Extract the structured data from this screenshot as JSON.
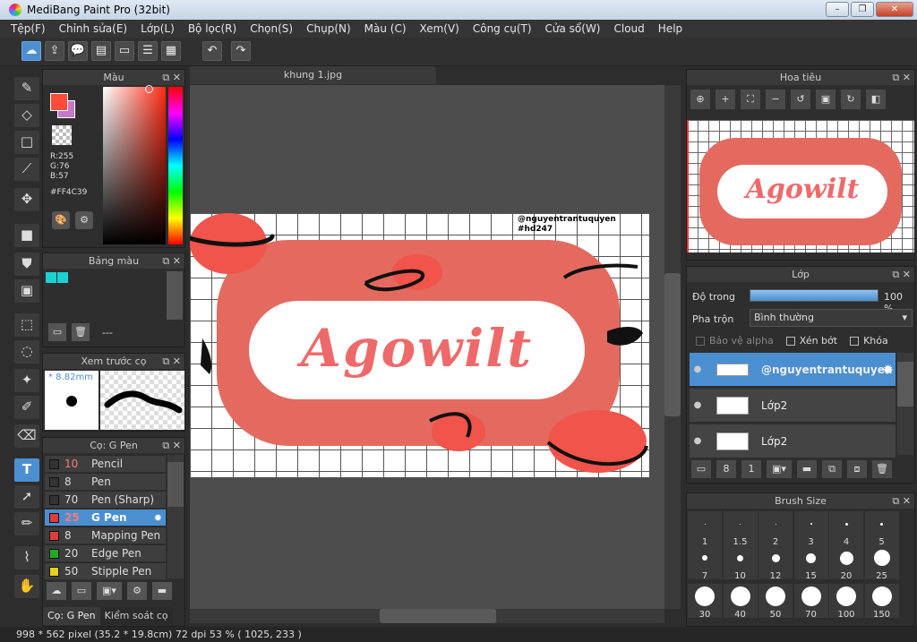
{
  "window": {
    "title": "MediBang Paint Pro (32bit)",
    "minimize": "–",
    "maximize": "❐",
    "close": "✕"
  },
  "menu": [
    "Tệp(F)",
    "Chỉnh sửa(E)",
    "Lớp(L)",
    "Bộ lọc(R)",
    "Chọn(S)",
    "Chụp(N)",
    "Màu (C)",
    "Xem(V)",
    "Công cụ(T)",
    "Cửa sổ(W)",
    "Cloud",
    "Help"
  ],
  "toolbar_icons": [
    "cloud-icon",
    "upload-icon",
    "speech-icon",
    "comment-icon",
    "page-icon",
    "list-icon",
    "edit-list-icon",
    "undo-icon",
    "redo-icon"
  ],
  "color_panel": {
    "title": "Màu",
    "r": "R:255",
    "g": "G:76",
    "b": "B:57",
    "hex": "#FF4C39",
    "fg": "#FF4C39",
    "bg": "#c678c8"
  },
  "palette_panel": {
    "title": "Bảng màu",
    "dash": "---",
    "swatches": [
      "#19d3d3",
      "#19d3d3"
    ]
  },
  "preview_panel": {
    "title": "Xem trước cọ",
    "size": "* 8.82mm"
  },
  "brush_panel": {
    "title": "Cọ: G Pen",
    "brushes": [
      {
        "size": "10",
        "name": "Pencil",
        "color": "#333333",
        "size_color": "#ff7a7a"
      },
      {
        "size": "8",
        "name": "Pen",
        "color": "#333333",
        "size_color": "#eeeeee"
      },
      {
        "size": "70",
        "name": "Pen (Sharp)",
        "color": "#333333",
        "size_color": "#eeeeee"
      },
      {
        "size": "25",
        "name": "G Pen",
        "color": "#e23b3b",
        "size_color": "#ff7a7a"
      },
      {
        "size": "8",
        "name": "Mapping Pen",
        "color": "#e23b3b",
        "size_color": "#eeeeee"
      },
      {
        "size": "20",
        "name": "Edge Pen",
        "color": "#22aa22",
        "size_color": "#eeeeee"
      },
      {
        "size": "50",
        "name": "Stipple Pen",
        "color": "#e8d020",
        "size_color": "#eeeeee"
      }
    ],
    "selected": 3,
    "tabs": [
      "Cọ: G Pen",
      "Kiểm soát cọ"
    ]
  },
  "document": {
    "tab": "khung 1.jpg",
    "watermark_1": "@nguyentrantuquyen",
    "watermark_2": "#hd247",
    "art_text": "Agowilt"
  },
  "navigator": {
    "title": "Hoa tiêu"
  },
  "layers": {
    "title": "Lớp",
    "opacity_label": "Độ trong",
    "opacity_value": "100 %",
    "opacity": 1.0,
    "blend_label": "Pha trộn",
    "blend_value": "Bình thường",
    "protect_alpha": "Bảo vệ alpha",
    "clip": "Xén bớt",
    "lock": "Khóa",
    "items": [
      {
        "name": "@nguyentrantuquyen",
        "selected": true
      },
      {
        "name": "Lớp2",
        "selected": false
      },
      {
        "name": "Lớp2",
        "selected": false
      }
    ]
  },
  "brush_size": {
    "title": "Brush Size",
    "row1": [
      "1",
      "1.5",
      "2",
      "3",
      "4",
      "5"
    ],
    "row2": [
      "7",
      "10",
      "12",
      "15",
      "20",
      "25"
    ],
    "row3": [
      "30",
      "40",
      "50",
      "70",
      "100",
      "150"
    ]
  },
  "status": "998 * 562 pixel   (35.2 * 19.8cm)   72 dpi   53 %   ( 1025, 233 )"
}
